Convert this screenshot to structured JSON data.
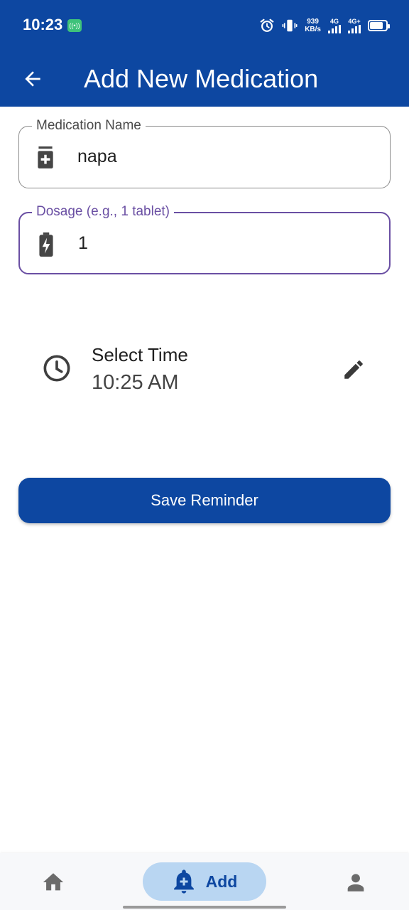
{
  "status_bar": {
    "time": "10:23",
    "net_speed_value": "939",
    "net_speed_unit": "KB/s",
    "signal1_label": "4G",
    "signal2_label": "4G+",
    "battery_level": 0.85,
    "icons": [
      "hotspot-icon",
      "alarm-icon",
      "vibrate-icon",
      "signal-icon",
      "battery-icon"
    ]
  },
  "app_bar": {
    "title": "Add New Medication",
    "back_icon": "arrow-back-icon"
  },
  "form": {
    "medication_name": {
      "label": "Medication Name",
      "value": "napa",
      "icon": "medication-bottle-icon"
    },
    "dosage": {
      "label": "Dosage (e.g., 1 tablet)",
      "value": "1",
      "icon": "battery-charging-icon"
    },
    "time": {
      "label": "Select Time",
      "value": "10:25 AM",
      "icon": "clock-icon",
      "edit_icon": "pencil-icon"
    },
    "save_label": "Save Reminder"
  },
  "bottom_nav": {
    "items": [
      {
        "icon": "home-icon",
        "label": ""
      },
      {
        "icon": "add-alert-icon",
        "label": "Add",
        "selected": true
      },
      {
        "icon": "person-icon",
        "label": ""
      }
    ]
  },
  "colors": {
    "primary": "#0d47a1",
    "focus": "#6a4fa3",
    "nav_pill": "#b9d6f2",
    "hotspot_badge": "#3ec27a"
  }
}
